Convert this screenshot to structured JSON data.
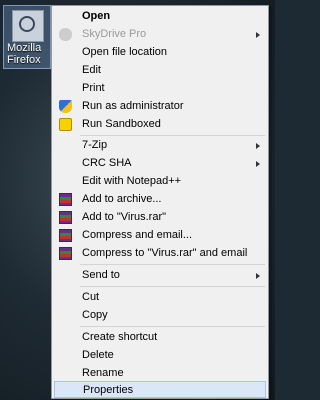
{
  "desktop": {
    "icon_label_line1": "Mozilla",
    "icon_label_line2": "Firefox"
  },
  "menu": {
    "items": [
      {
        "label": "Open",
        "bold": true
      },
      {
        "label": "SkyDrive Pro",
        "disabled": true,
        "submenu": true
      },
      {
        "label": "Open file location"
      },
      {
        "label": "Edit"
      },
      {
        "label": "Print"
      },
      {
        "label": "Run as administrator",
        "icon": "shield-icon"
      },
      {
        "label": "Run Sandboxed",
        "icon": "sandbox-icon"
      },
      {
        "label": "7-Zip",
        "submenu": true
      },
      {
        "label": "CRC SHA",
        "submenu": true
      },
      {
        "label": "Edit with Notepad++"
      },
      {
        "label": "Add to archive...",
        "icon": "winrar-icon"
      },
      {
        "label": "Add to \"Virus.rar\"",
        "icon": "winrar-icon"
      },
      {
        "label": "Compress and email...",
        "icon": "winrar-icon"
      },
      {
        "label": "Compress to \"Virus.rar\" and email",
        "icon": "winrar-icon"
      },
      {
        "label": "Send to",
        "submenu": true
      },
      {
        "label": "Cut"
      },
      {
        "label": "Copy"
      },
      {
        "label": "Create shortcut"
      },
      {
        "label": "Delete"
      },
      {
        "label": "Rename"
      },
      {
        "label": "Properties",
        "highlighted": true
      }
    ]
  }
}
